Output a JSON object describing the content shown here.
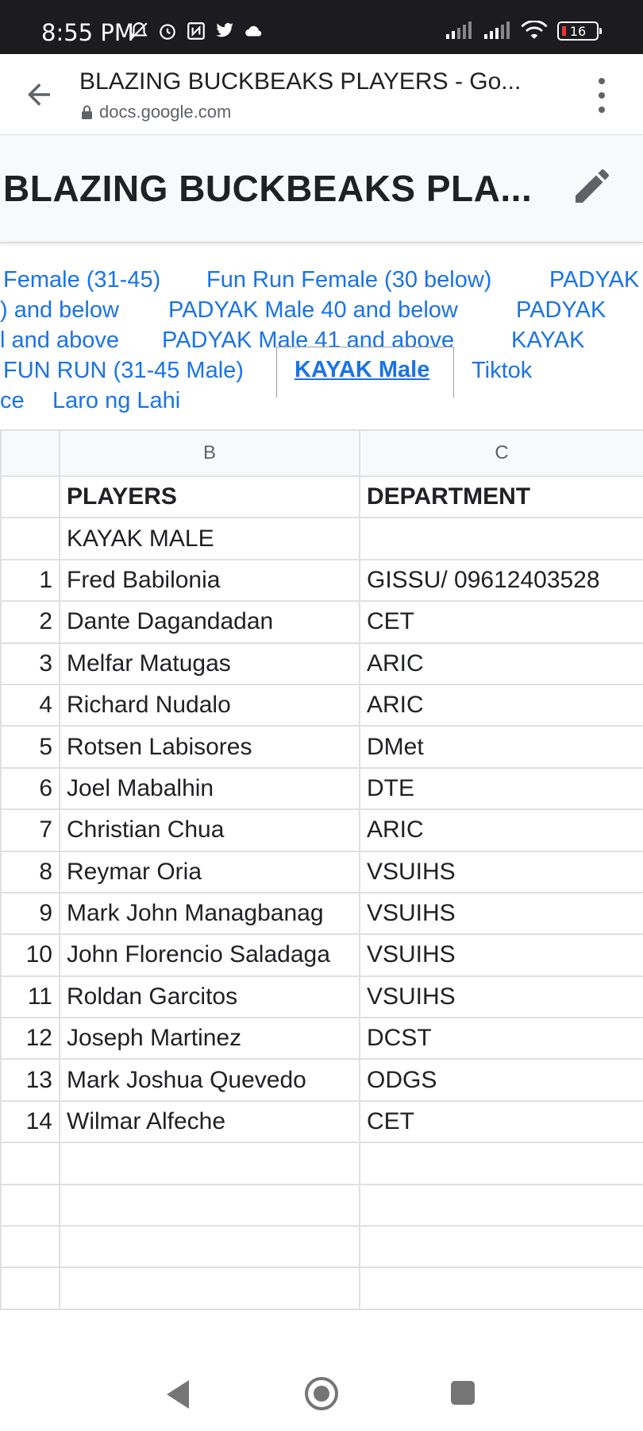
{
  "status_bar": {
    "time": "8:55 PM",
    "battery": "16",
    "icons_left": [
      "mute-icon",
      "alarm-icon",
      "nfc-icon",
      "twitter-icon",
      "cloud-icon"
    ],
    "icons_right": [
      "signal-icon",
      "signal-icon",
      "wifi-icon",
      "battery-icon"
    ]
  },
  "browser": {
    "title": "BLAZING BUCKBEAKS PLAYERS - Go...",
    "url": "docs.google.com"
  },
  "doc": {
    "title": "BLAZING BUCKBEAKS PLA..."
  },
  "tabs": [
    "Female (31-45)",
    "Fun Run Female (30 below)",
    "PADYAK",
    ") and below",
    "PADYAK Male 40 and below",
    "PADYAK",
    "l and above",
    "PADYAK Male 41 and above",
    "KAYAK",
    "FUN RUN (31-45 Male)",
    "KAYAK Male",
    "Tiktok",
    "ce",
    "Laro ng Lahi"
  ],
  "grid": {
    "columns": [
      "",
      "B",
      "C"
    ],
    "rows": [
      {
        "num": "",
        "b": "PLAYERS",
        "c": "DEPARTMENT"
      },
      {
        "num": "",
        "b": "KAYAK MALE",
        "c": ""
      },
      {
        "num": "1",
        "b": "Fred Babilonia",
        "c": "GISSU/ 09612403528"
      },
      {
        "num": "2",
        "b": "Dante Dagandadan",
        "c": "CET"
      },
      {
        "num": "3",
        "b": "Melfar Matugas",
        "c": "ARIC"
      },
      {
        "num": "4",
        "b": "Richard Nudalo",
        "c": "ARIC"
      },
      {
        "num": "5",
        "b": "Rotsen Labisores",
        "c": "DMet"
      },
      {
        "num": "6",
        "b": "Joel Mabalhin",
        "c": "DTE"
      },
      {
        "num": "7",
        "b": "Christian Chua",
        "c": "ARIC"
      },
      {
        "num": "8",
        "b": "Reymar Oria",
        "c": "VSUIHS"
      },
      {
        "num": "9",
        "b": "Mark John Managbanag",
        "c": "VSUIHS"
      },
      {
        "num": "10",
        "b": "John Florencio Saladaga",
        "c": "VSUIHS"
      },
      {
        "num": "11",
        "b": "Roldan Garcitos",
        "c": "VSUIHS"
      },
      {
        "num": "12",
        "b": "Joseph Martinez",
        "c": "DCST"
      },
      {
        "num": "13",
        "b": "Mark Joshua Quevedo",
        "c": "ODGS"
      },
      {
        "num": "14",
        "b": "Wilmar Alfeche",
        "c": "CET"
      },
      {
        "num": "",
        "b": "",
        "c": ""
      },
      {
        "num": "",
        "b": "",
        "c": ""
      },
      {
        "num": "",
        "b": "",
        "c": ""
      },
      {
        "num": "",
        "b": "",
        "c": ""
      }
    ]
  },
  "colors": {
    "status_bar_bg": "#1c1c1e",
    "link": "#1a73e8",
    "grid_line": "#e0e0e0",
    "header_bg": "#f8f9fa"
  }
}
